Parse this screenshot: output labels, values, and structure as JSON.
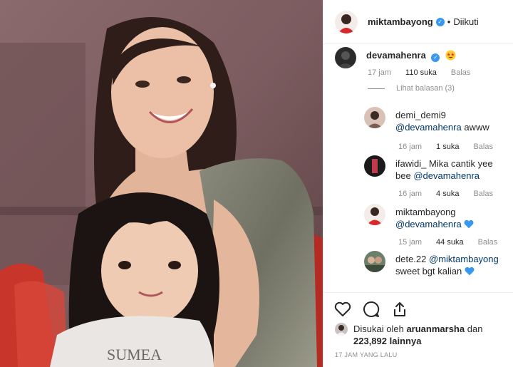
{
  "header": {
    "username": "miktambayong",
    "verified": true,
    "separator": "•",
    "follow_state": "Diikuti"
  },
  "comments": [
    {
      "username": "devamahenra",
      "verified": true,
      "text": "",
      "emoji": "star-struck",
      "time": "17 jam",
      "likes": "110 suka",
      "reply": "Balas",
      "view_replies": "Lihat balasan (3)"
    },
    {
      "username": "demi_demi9",
      "mention": "@devamahenra",
      "text": "awww",
      "time": "16 jam",
      "likes": "1 suka",
      "reply": "Balas"
    },
    {
      "username": "ifawidi_",
      "text": "Mika cantik yee bee",
      "mention": "@devamahenra",
      "time": "16 jam",
      "likes": "4 suka",
      "reply": "Balas"
    },
    {
      "username": "miktambayong",
      "mention": "@devamahenra",
      "emoji": "blue-heart",
      "time": "15 jam",
      "likes": "44 suka",
      "reply": "Balas"
    },
    {
      "username": "dete.22",
      "mention": "@miktambayong",
      "text": "sweet bgt kalian",
      "emoji": "blue-heart"
    }
  ],
  "actions": {
    "like_icon": "heart-outline-icon",
    "comment_icon": "comment-bubble-icon",
    "share_icon": "share-upload-icon"
  },
  "likes": {
    "prefix": "Disukai oleh",
    "user": "aruanmarsha",
    "and": "dan",
    "count": "223,892",
    "suffix": "lainnya"
  },
  "posted": "17 JAM YANG LALU",
  "colors": {
    "link": "#00376b",
    "verified": "#3897f0",
    "muted": "#8e8e8e",
    "heart_blue": "#3897f0"
  }
}
